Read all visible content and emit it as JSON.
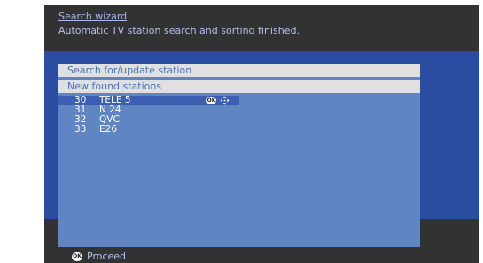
{
  "header": {
    "title": "Search wizard",
    "subtitle": "Automatic TV station search and sorting finished."
  },
  "panel": {
    "row1": "Search for/update station",
    "row2": "New found stations",
    "stations": [
      {
        "number": "30",
        "name": "TELE 5",
        "selected": true
      },
      {
        "number": "31",
        "name": "N 24",
        "selected": false
      },
      {
        "number": "32",
        "name": "QVC",
        "selected": false
      },
      {
        "number": "33",
        "name": "E26",
        "selected": false
      }
    ]
  },
  "footer": {
    "ok_label": "OK",
    "proceed_label": "Proceed"
  },
  "colors": {
    "background": "#333333",
    "band": "#2b4da1",
    "panel": "#5f86c2",
    "selected_row": "#3d5fb1",
    "header_text": "#a9b9ea"
  },
  "icons": [
    "ok-icon",
    "nav-arrows-icon"
  ]
}
